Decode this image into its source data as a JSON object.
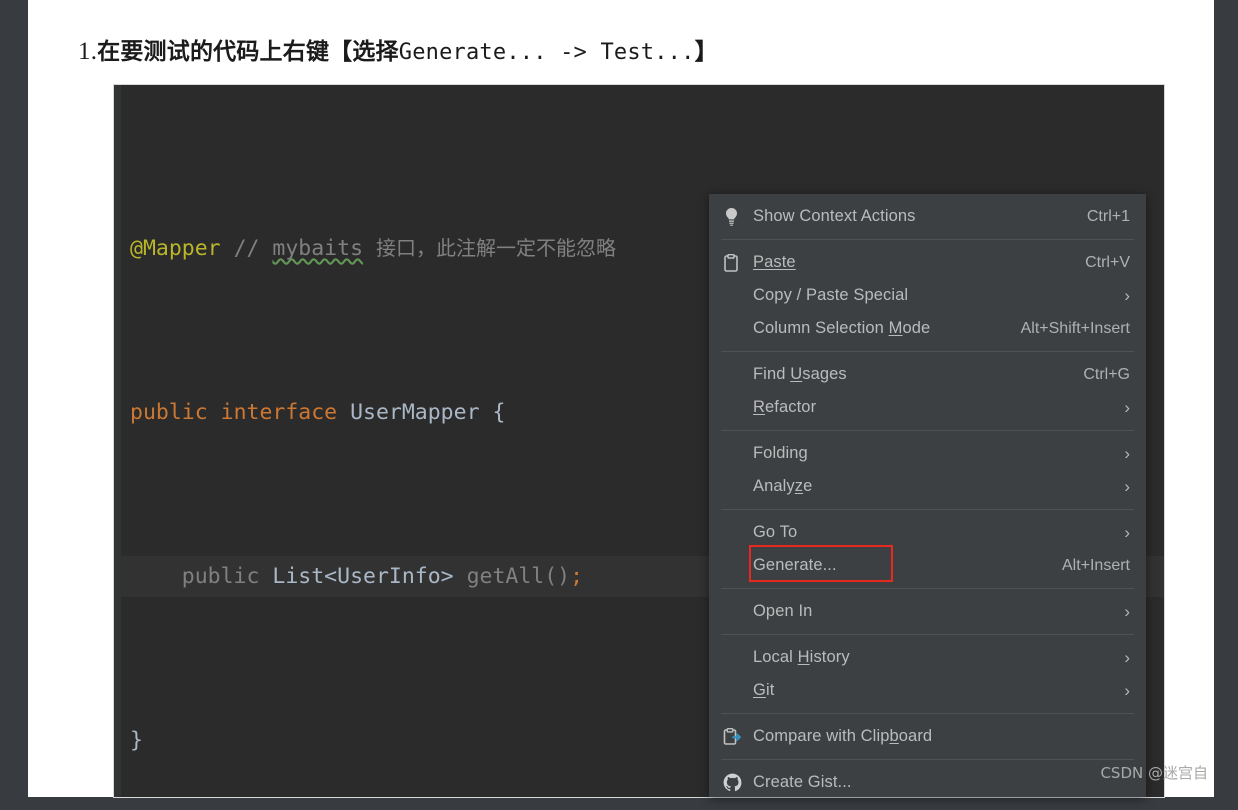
{
  "heading": {
    "number": "1.",
    "chinese_lead": "在要测试的代码上右键",
    "bracket_open": "【",
    "select_word": "选择",
    "mono_text": "Generate... -> Test...",
    "bracket_close": "】"
  },
  "editor": {
    "background_color": "#2b2b2b",
    "caret_line_color": "#323232",
    "lines": [
      {
        "annotation": "@Mapper",
        "comment_slashes": "//",
        "comment_word": "mybaits",
        "comment_rest": "接口，此注解一定不能忽略"
      },
      {
        "kw1": "public",
        "kw2": "interface",
        "type_name": "UserMapper",
        "brace": "{"
      },
      {
        "modifier": "public",
        "return_type": "List<UserInfo>",
        "method": "getAll()",
        "semicolon": ";"
      },
      {
        "brace": "}"
      }
    ]
  },
  "context_menu": {
    "background_color": "#3c4043",
    "groups": [
      {
        "items": [
          {
            "icon": "lightbulb-icon",
            "label": "Show Context Actions",
            "accelerator": "Ctrl+1",
            "submenu": false,
            "mnemonic": ""
          }
        ]
      },
      {
        "items": [
          {
            "icon": "clipboard-icon",
            "label": "Paste",
            "accelerator": "Ctrl+V",
            "submenu": false,
            "mnemonic": "P"
          },
          {
            "icon": "",
            "label": "Copy / Paste Special",
            "accelerator": "",
            "submenu": true,
            "mnemonic": ""
          },
          {
            "icon": "",
            "label": "Column Selection Mode",
            "accelerator": "Alt+Shift+Insert",
            "submenu": false,
            "mnemonic": "M"
          }
        ]
      },
      {
        "items": [
          {
            "icon": "",
            "label": "Find Usages",
            "accelerator": "Ctrl+G",
            "submenu": false,
            "mnemonic": "U"
          },
          {
            "icon": "",
            "label": "Refactor",
            "accelerator": "",
            "submenu": true,
            "mnemonic": "R"
          }
        ]
      },
      {
        "items": [
          {
            "icon": "",
            "label": "Folding",
            "accelerator": "",
            "submenu": true,
            "mnemonic": ""
          },
          {
            "icon": "",
            "label": "Analyze",
            "accelerator": "",
            "submenu": true,
            "mnemonic": "z"
          }
        ]
      },
      {
        "items": [
          {
            "icon": "",
            "label": "Go To",
            "accelerator": "",
            "submenu": true,
            "mnemonic": ""
          },
          {
            "icon": "",
            "label": "Generate...",
            "accelerator": "Alt+Insert",
            "submenu": false,
            "mnemonic": "",
            "highlighted": true
          }
        ]
      },
      {
        "items": [
          {
            "icon": "",
            "label": "Open In",
            "accelerator": "",
            "submenu": true,
            "mnemonic": ""
          }
        ]
      },
      {
        "items": [
          {
            "icon": "",
            "label": "Local History",
            "accelerator": "",
            "submenu": true,
            "mnemonic": "H"
          },
          {
            "icon": "",
            "label": "Git",
            "accelerator": "",
            "submenu": true,
            "mnemonic": "G"
          }
        ]
      },
      {
        "items": [
          {
            "icon": "compare-clipboard-icon",
            "label": "Compare with Clipboard",
            "accelerator": "",
            "submenu": false,
            "mnemonic": "b"
          }
        ]
      },
      {
        "items": [
          {
            "icon": "github-icon",
            "label": "Create Gist...",
            "accelerator": "",
            "submenu": false,
            "mnemonic": ""
          }
        ]
      }
    ]
  },
  "annotation": {
    "color": "#e8291f",
    "target_label": "Generate..."
  },
  "watermark": {
    "text": "CSDN @迷宫自"
  }
}
